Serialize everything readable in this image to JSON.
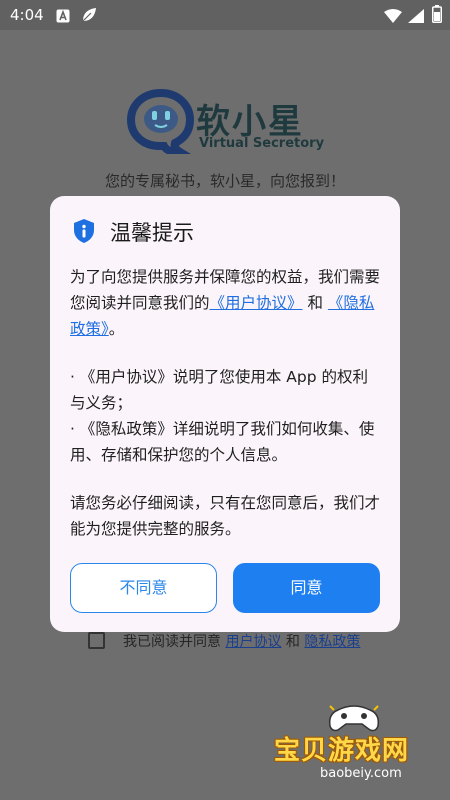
{
  "status_bar": {
    "time": "4:04",
    "icons": [
      "a-icon",
      "leaf-icon",
      "wifi-icon",
      "signal-icon",
      "battery-icon"
    ]
  },
  "app": {
    "name": "软小星",
    "subtitle": "Virtual Secretory",
    "tagline": "您的专属秘书，软小星，向您报到！",
    "logo_icon": "chat-bubble-face-icon"
  },
  "dialog": {
    "icon": "shield-info-icon",
    "title": "温馨提示",
    "intro_before": "为了向您提供服务并保障您的权益，我们需要您阅读并同意我们的",
    "intro_link_user": "《用户协议》",
    "intro_and": " 和 ",
    "intro_link_privacy": "《隐私政策》",
    "intro_after": "。",
    "bullet_user": "· 《用户协议》说明了您使用本 App 的权利与义务；",
    "bullet_privacy": "· 《隐私政策》详细说明了我们如何收集、使用、存储和保护您的个人信息。",
    "closing": "请您务必仔细阅读，只有在您同意后，我们才能为您提供完整的服务。",
    "btn_disagree": "不同意",
    "btn_agree": "同意"
  },
  "consent": {
    "text": "我已阅读并同意",
    "link_user": "用户协议",
    "and": "和",
    "link_privacy": "隐私政策"
  },
  "watermark": {
    "title": "宝贝游戏网",
    "url": "baobeiy.com"
  },
  "colors": {
    "accent": "#1e7ff0",
    "link": "#1f6fe0",
    "overlay": "#6e6e6e",
    "dialog_bg": "#fbf5fb"
  }
}
